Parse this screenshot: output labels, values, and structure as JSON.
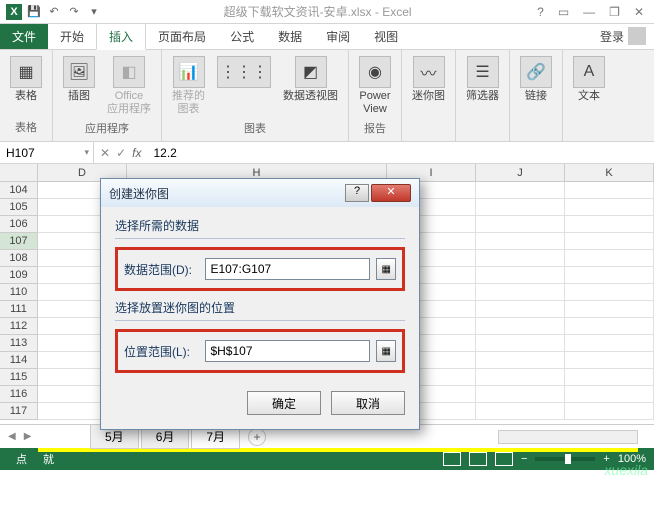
{
  "app": {
    "title": "超级下载软文资讯-安卓.xlsx - Excel"
  },
  "qat": {
    "save": "💾",
    "undo": "↶",
    "redo": "↷"
  },
  "wincontrols": {
    "help": "?",
    "ribbon_opts": "▭",
    "min": "—",
    "restore": "❐",
    "close": "✕"
  },
  "tabs": {
    "file": "文件",
    "home": "开始",
    "insert": "插入",
    "layout": "页面布局",
    "formulas": "公式",
    "data": "数据",
    "review": "审阅",
    "view": "视图",
    "login": "登录"
  },
  "ribbon": {
    "tables": {
      "btn": "表格",
      "group": "表格"
    },
    "illustrations": {
      "pic": "插图",
      "office": "Office\n应用程序",
      "group": "应用程序"
    },
    "charts": {
      "rec": "推荐的\n图表",
      "pivot": "数据透视图",
      "group": "图表"
    },
    "reports": {
      "power": "Power\nView",
      "group": "报告"
    },
    "sparklines": {
      "btn": "迷你图"
    },
    "filters": {
      "btn": "筛选器"
    },
    "links": {
      "btn": "链接"
    },
    "text": {
      "btn": "文本"
    }
  },
  "namebox": "H107",
  "formula": "12.2",
  "columns": [
    "D",
    "H",
    "I",
    "J",
    "K"
  ],
  "rows": [
    "104",
    "105",
    "106",
    "107",
    "108",
    "109",
    "110",
    "111",
    "112",
    "113",
    "114",
    "115",
    "116",
    "117"
  ],
  "selected_row": "107",
  "sheets": {
    "s1": "5月",
    "s2": "6月",
    "s3": "7月",
    "add": "+",
    "nav_l": "◀",
    "nav_r": "▶"
  },
  "status": {
    "ready": "点",
    "mode": "就",
    "zoom": "100%",
    "minus": "−",
    "plus": "+"
  },
  "dialog": {
    "title": "创建迷你图",
    "section1": "选择所需的数据",
    "field1_label": "数据范围(D):",
    "field1_value": "E107:G107",
    "section2": "选择放置迷你图的位置",
    "field2_label": "位置范围(L):",
    "field2_value": "$H$107",
    "ok": "确定",
    "cancel": "取消",
    "help": "?",
    "close": "✕"
  },
  "watermark": "xuexila"
}
